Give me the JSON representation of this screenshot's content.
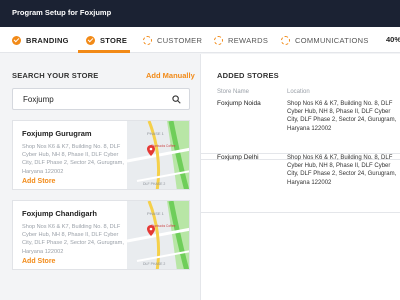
{
  "header": {
    "title": "Program Setup for Foxjump"
  },
  "steps": [
    {
      "label": "BRANDING",
      "state": "done"
    },
    {
      "label": "STORE",
      "state": "active"
    },
    {
      "label": "CUSTOMER",
      "state": "pending"
    },
    {
      "label": "REWARDS",
      "state": "pending"
    },
    {
      "label": "COMMUNICATIONS",
      "state": "pending"
    }
  ],
  "progress": {
    "label": "40%",
    "value": 40
  },
  "search_section": {
    "title": "SEARCH YOUR STORE",
    "add_manually": "Add Manually",
    "search_value": "Foxjump",
    "icon": "search-icon"
  },
  "results": [
    {
      "name": "Foxjump Gurugram",
      "address": "Shop Nos K6 & K7, Building No. 8, DLF Cyber Hub, NH 8, Phase II, DLF Cyber City, DLF Phase 2, Sector 24, Gurugram, Haryana 122002",
      "action": "Add Store",
      "map_labels": {
        "phase": "PHASE 1",
        "poi": "Starbucks Coffee",
        "road": "DLF PHASE 2"
      }
    },
    {
      "name": "Foxjump Chandigarh",
      "address": "Shop Nos K6 & K7, Building No. 8, DLF Cyber Hub, NH 8, Phase II, DLF Cyber City, DLF Phase 2, Sector 24, Gurugram, Haryana 122002",
      "action": "Add Store",
      "map_labels": {
        "phase": "PHASE 1",
        "poi": "Starbucks Coffee",
        "road": "DLF PHASE 2"
      }
    }
  ],
  "added_section": {
    "title": "ADDED STORES",
    "col_name": "Store Name",
    "col_location": "Location",
    "stores": [
      {
        "name": "Foxjump Noida",
        "location": "Shop Nos K6 & K7, Building No. 8, DLF Cyber Hub, NH 8, Phase II, DLF Cyber City, DLF Phase 2, Sector 24, Gurugram, Haryana 122002"
      },
      {
        "name": "Foxjump Delhi",
        "location": "Shop Nos K6 & K7, Building No. 8, DLF Cyber Hub, NH 8, Phase II, DLF Cyber City, DLF Phase 2, Sector 24, Gurugram, Haryana 122002"
      }
    ]
  },
  "colors": {
    "accent": "#f28a17",
    "header_bg": "#1b2233",
    "map_road": "#f5d04a",
    "map_green": "#6fce5a",
    "pin": "#e53935"
  }
}
